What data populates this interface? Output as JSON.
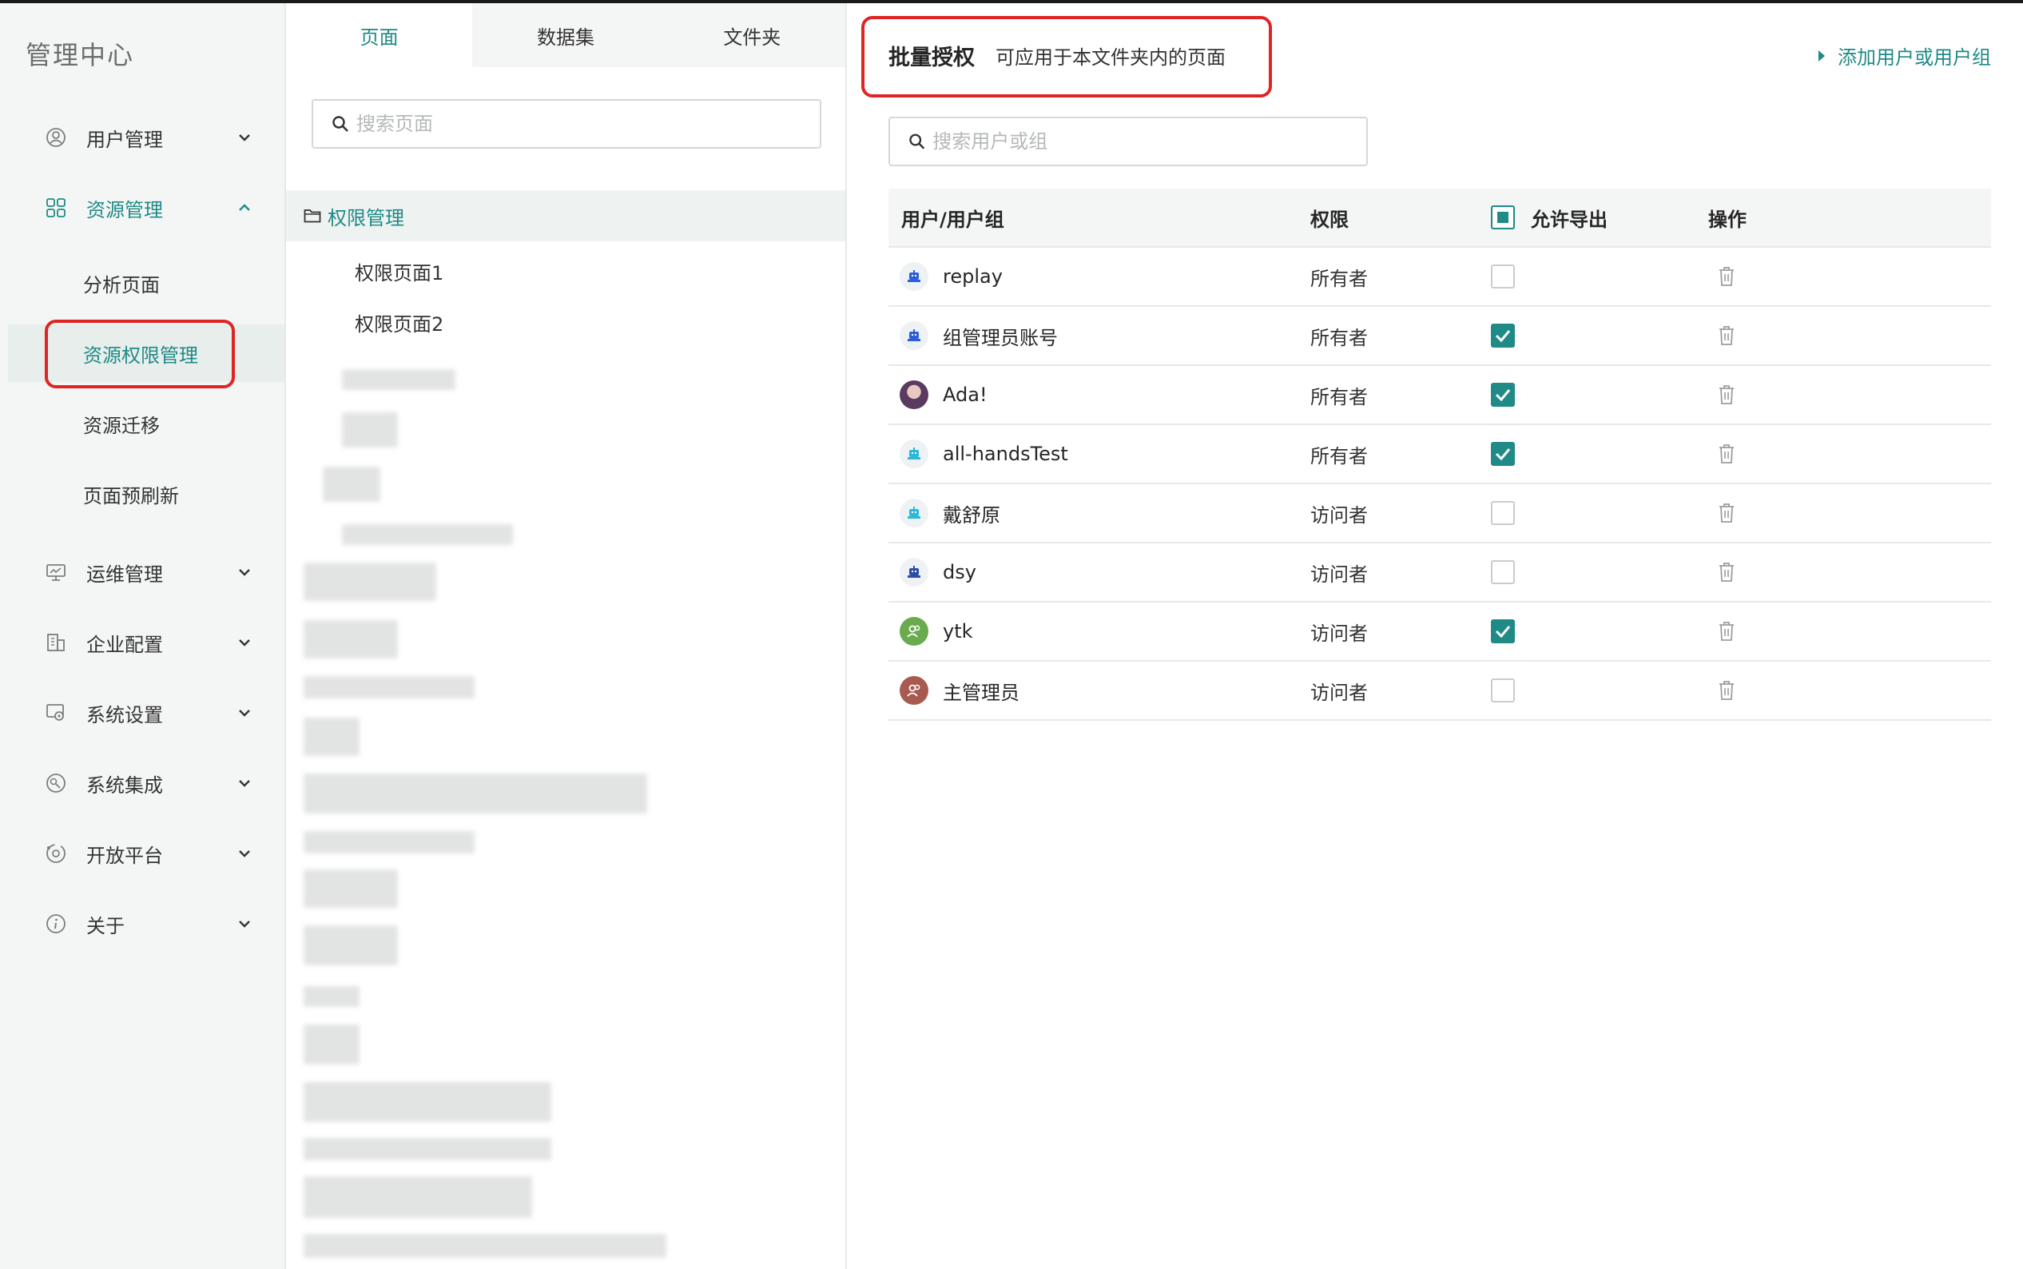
{
  "sidebar": {
    "brand": "管理中心",
    "menu": [
      {
        "label": "用户管理",
        "icon": "user-circle-icon",
        "expanded": false
      },
      {
        "label": "资源管理",
        "icon": "grid-icon",
        "expanded": true,
        "children": [
          "分析页面",
          "资源权限管理",
          "资源迁移",
          "页面预刷新"
        ],
        "selected": "资源权限管理"
      },
      {
        "label": "运维管理",
        "icon": "monitor-icon",
        "expanded": false
      },
      {
        "label": "企业配置",
        "icon": "building-icon",
        "expanded": false
      },
      {
        "label": "系统设置",
        "icon": "settings-screen-icon",
        "expanded": false
      },
      {
        "label": "系统集成",
        "icon": "integration-icon",
        "expanded": false
      },
      {
        "label": "开放平台",
        "icon": "open-platform-icon",
        "expanded": false
      },
      {
        "label": "关于",
        "icon": "info-icon",
        "expanded": false
      }
    ]
  },
  "middle": {
    "tabs": [
      "页面",
      "数据集",
      "文件夹"
    ],
    "active_tab": "页面",
    "search_placeholder": "搜索页面",
    "folder": "权限管理",
    "pages": [
      "权限页面1",
      "权限页面2"
    ]
  },
  "right": {
    "title": "批量授权",
    "subtitle": "可应用于本文件夹内的页面",
    "add_link": "添加用户或用户组",
    "search_placeholder": "搜索用户或组",
    "columns": {
      "user": "用户/用户组",
      "permission": "权限",
      "export": "允许导出",
      "action": "操作"
    },
    "rows": [
      {
        "name": "replay",
        "permission": "所有者",
        "export": false,
        "avatar": "robot-avatar-icon",
        "color": "#2b5fd9"
      },
      {
        "name": "组管理员账号",
        "permission": "所有者",
        "export": true,
        "avatar": "robot-avatar-icon",
        "color": "#2b5fd9"
      },
      {
        "name": "Ada!",
        "permission": "所有者",
        "export": true,
        "avatar": "photo-avatar",
        "color": "#5a3a5e"
      },
      {
        "name": "all-handsTest",
        "permission": "所有者",
        "export": true,
        "avatar": "robot-avatar-icon",
        "color": "#2bb8d9"
      },
      {
        "name": "戴舒原",
        "permission": "访问者",
        "export": false,
        "avatar": "robot-avatar-icon",
        "color": "#2bb8d9"
      },
      {
        "name": "dsy",
        "permission": "访问者",
        "export": false,
        "avatar": "robot-avatar-icon",
        "color": "#2b4fa8"
      },
      {
        "name": "ytk",
        "permission": "访问者",
        "export": true,
        "avatar": "group-avatar-icon",
        "color": "#6aab4f"
      },
      {
        "name": "主管理员",
        "permission": "访问者",
        "export": false,
        "avatar": "group-avatar-icon",
        "color": "#a85a50"
      }
    ]
  },
  "colors": {
    "accent": "#1f8a86",
    "highlight_box": "#e02424"
  }
}
